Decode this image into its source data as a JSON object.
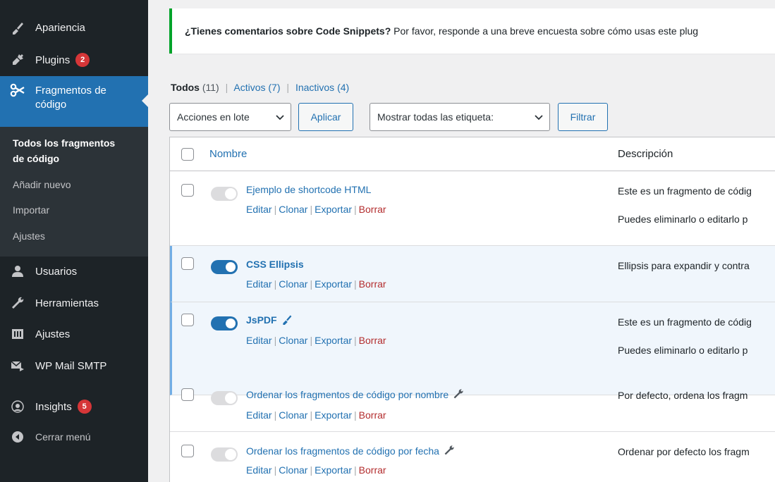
{
  "sidebar": {
    "items_top": [
      {
        "label": "Apariencia",
        "icon": "brush-icon"
      },
      {
        "label": "Plugins",
        "icon": "plug-icon",
        "badge": "2"
      }
    ],
    "active": {
      "label_line1": "Fragmentos de",
      "label_line2": "código",
      "icon": "scissors-icon"
    },
    "submenu": {
      "current_line1": "Todos los fragmentos",
      "current_line2": "de código",
      "items": [
        "Añadir nuevo",
        "Importar",
        "Ajustes"
      ]
    },
    "items_bottom": [
      {
        "label": "Usuarios",
        "icon": "user-icon"
      },
      {
        "label": "Herramientas",
        "icon": "wrench-icon"
      },
      {
        "label": "Ajustes",
        "icon": "settings-icon"
      },
      {
        "label": "WP Mail SMTP",
        "icon": "mail-icon"
      },
      {
        "label": "Insights",
        "icon": "insights-icon",
        "badge": "5"
      },
      {
        "label": "Cerrar menú",
        "icon": "collapse-icon"
      }
    ]
  },
  "notice": {
    "bold": "¿Tienes comentarios sobre Code Snippets?",
    "text": " Por favor, responde a una breve encuesta sobre cómo usas este plug"
  },
  "filters": {
    "all": "Todos",
    "all_count": "(11)",
    "active": "Activos",
    "active_count": "(7)",
    "inactive": "Inactivos",
    "inactive_count": "(4)",
    "separator": "|"
  },
  "toolbar": {
    "bulk_select": "Acciones en lote",
    "apply": "Aplicar",
    "tags_select": "Mostrar todas las etiqueta:",
    "filter": "Filtrar"
  },
  "table": {
    "col_name": "Nombre",
    "col_desc": "Descripción",
    "action_labels": {
      "edit": "Editar",
      "clone": "Clonar",
      "export": "Exportar",
      "delete": "Borrar"
    },
    "rows": [
      {
        "title": "Ejemplo de shortcode HTML",
        "active": false,
        "desc1": "Este es un fragmento de códig",
        "desc2": "Puedes eliminarlo o editarlo p"
      },
      {
        "title": "CSS Ellipsis",
        "active": true,
        "desc1": "Ellipsis para expandir y contra",
        "desc2": ""
      },
      {
        "title": "JsPDF",
        "active": true,
        "icon": "pin-icon",
        "desc1": "Este es un fragmento de códig",
        "desc2": "Puedes eliminarlo o editarlo p"
      },
      {
        "title": "Ordenar los fragmentos de código por nombre",
        "active": false,
        "icon": "wrench-icon",
        "desc1": "Por defecto, ordena los fragm",
        "desc2": ""
      },
      {
        "title": "Ordenar los fragmentos de código por fecha",
        "active": false,
        "icon": "wrench-icon",
        "desc1": "Ordenar por defecto los fragm",
        "desc2": ""
      }
    ]
  },
  "colors": {
    "accent": "#2271b1",
    "sidebar": "#1d2327",
    "success": "#00a32a",
    "danger": "#b32d2e"
  }
}
